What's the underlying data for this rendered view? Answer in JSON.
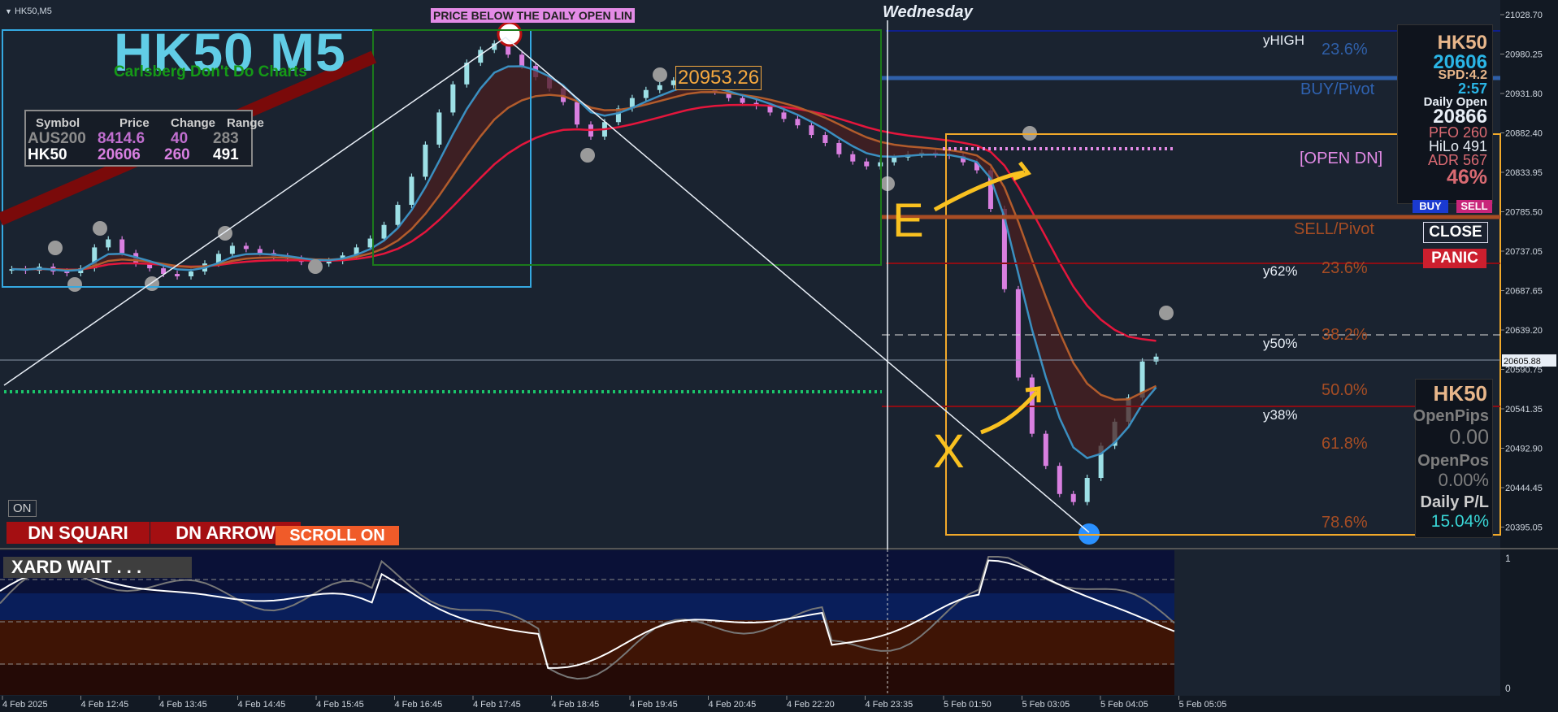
{
  "window": {
    "symbol_tab": "HK50,M5"
  },
  "header": {
    "title": "HK50 M5",
    "subtitle": "Carlsberg Don't Do Charts",
    "alert_banner": "PRICE BELOW THE DAILY OPEN LIN",
    "day_label": "Wednesday"
  },
  "watchlist": {
    "headers": [
      "Symbol",
      "Price",
      "Change",
      "Range"
    ],
    "rows": [
      {
        "symbol": "AUS200",
        "price": "8414.6",
        "change": "40",
        "range": "283"
      },
      {
        "symbol": "HK50",
        "price": "20606",
        "change": "260",
        "range": "491"
      }
    ]
  },
  "price_callout": "20953.26",
  "levels": {
    "yhigh": "yHIGH",
    "y62": "y62%",
    "y50": "y50%",
    "y38": "y38%",
    "fib_upper": [
      "23.6%",
      "23.6%",
      "38.2%",
      "50.0%",
      "61.8%",
      "78.6%"
    ],
    "buy_pivot": "BUY/Pivot",
    "sell_pivot": "SELL/Pivot",
    "open_dn": "[OPEN DN]"
  },
  "info_panel": {
    "symbol": "HK50",
    "price": "20606",
    "spread": "SPD:4.2",
    "timer": "2:57",
    "daily_open_label": "Daily Open",
    "daily_open": "20866",
    "pfo": "PFO 260",
    "hilo": "HiLo 491",
    "adr": "ADR 567",
    "pct": "46%"
  },
  "trade_buttons": {
    "buy": "BUY",
    "sell": "SELL",
    "close": "CLOSE",
    "panic": "PANIC"
  },
  "position_panel": {
    "symbol": "HK50",
    "open_pips_label": "OpenPips",
    "open_pips": "0.00",
    "open_pos_label": "OpenPos",
    "open_pos": "0.00%",
    "daily_pl_label": "Daily P/L",
    "daily_pl": "15.04%"
  },
  "bottom_controls": {
    "on": "ON",
    "square": "DN SQUARI",
    "arrow": "DN ARROW",
    "scroll": "SCROLL ON"
  },
  "annotations": {
    "e": "E",
    "x": "X"
  },
  "oscillator": {
    "label": "XARD WAIT . . .",
    "scale_top": "1",
    "scale_bottom": "0"
  },
  "price_axis": {
    "ticks": [
      "21028.70",
      "20980.25",
      "20931.80",
      "20882.40",
      "20833.95",
      "20785.50",
      "20737.05",
      "20687.65",
      "20639.20",
      "20590.75",
      "20541.35",
      "20492.90",
      "20444.45",
      "20395.05"
    ],
    "current": "20605.88"
  },
  "time_axis": {
    "ticks": [
      "4 Feb 2025",
      "4 Feb 12:45",
      "4 Feb 13:45",
      "4 Feb 14:45",
      "4 Feb 15:45",
      "4 Feb 16:45",
      "4 Feb 17:45",
      "4 Feb 18:45",
      "4 Feb 19:45",
      "4 Feb 20:45",
      "4 Feb 22:20",
      "4 Feb 23:35",
      "5 Feb 01:50",
      "5 Feb 03:05",
      "5 Feb 04:05",
      "5 Feb 05:05"
    ]
  },
  "chart_data": {
    "type": "candlestick",
    "title": "HK50 M5",
    "ylim": [
      20370,
      21045
    ],
    "close": [
      20715,
      20713,
      20718,
      20712,
      20710,
      20716,
      20742,
      20752,
      20735,
      20722,
      20716,
      20709,
      20706,
      20712,
      20722,
      20734,
      20744,
      20740,
      20735,
      20731,
      20728,
      20724,
      20722,
      20725,
      20732,
      20742,
      20753,
      20770,
      20795,
      20830,
      20870,
      20910,
      20945,
      20972,
      20988,
      20996,
      20982,
      20968,
      20954,
      20940,
      20923,
      20895,
      20880,
      20898,
      20915,
      20928,
      20938,
      20944,
      20950,
      20953,
      20945,
      20936,
      20928,
      20922,
      20918,
      20910,
      20902,
      20894,
      20882,
      20872,
      20858,
      20849,
      20843,
      20848,
      20854,
      20858,
      20860,
      20858,
      20856,
      20848,
      20838,
      20790,
      20690,
      20580,
      20510,
      20470,
      20435,
      20425,
      20455,
      20495,
      20525,
      20555,
      20600,
      20606
    ],
    "colors": {
      "bull": "#9de0e6",
      "bear": "#d97fe0",
      "ema_fast": "#3b8fc0",
      "ema_slow": "#b25c2c",
      "ema_green": "#41c441",
      "ema_red": "#e4163c"
    }
  }
}
